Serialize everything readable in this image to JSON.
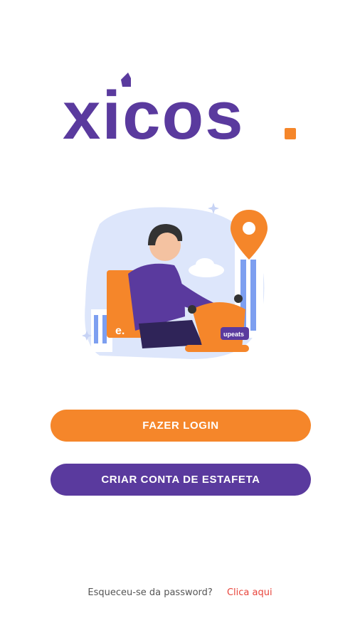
{
  "logo": {
    "text": "xicos",
    "dot_color": "#f5862a",
    "text_color": "#5a3a9e"
  },
  "illustration": {
    "icon": "delivery-scooter-illustration",
    "box_label": "e.",
    "scooter_label": "upeats"
  },
  "buttons": {
    "login_label": "FAZER LOGIN",
    "create_label": "CRIAR CONTA DE ESTAFETA"
  },
  "footer": {
    "forgot_text": "Esqueceu-se da password?",
    "link_text": "Clica aqui"
  },
  "colors": {
    "accent_orange": "#f5862a",
    "brand_purple": "#5a3a9e",
    "link_red": "#e8453c"
  }
}
